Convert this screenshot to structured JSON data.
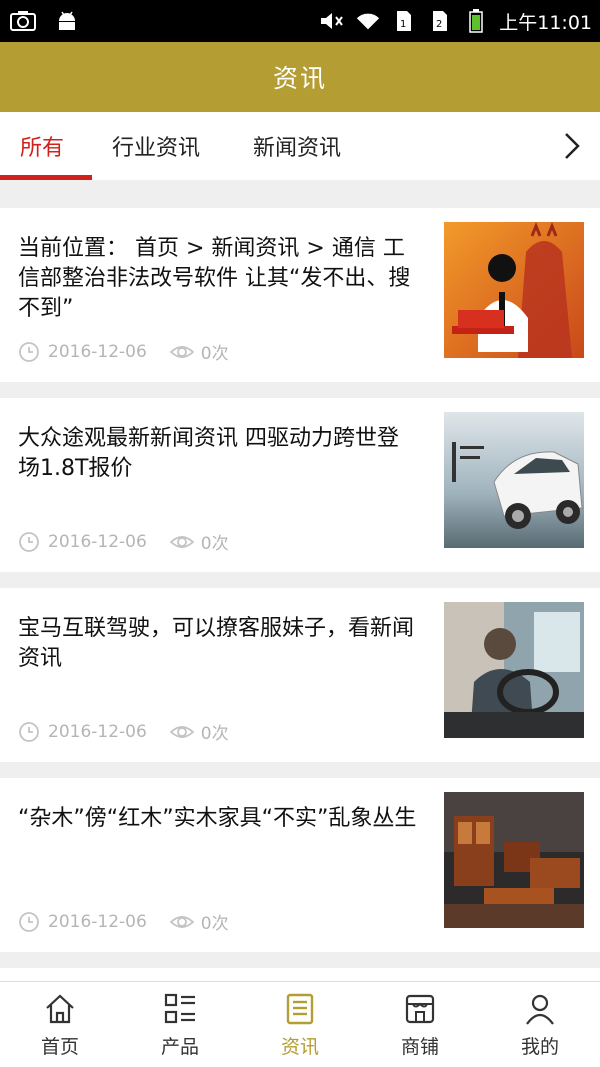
{
  "status_bar": {
    "time": "上午11:01",
    "icons_left": [
      "screenshot-icon",
      "android-icon"
    ],
    "icons_right": [
      "mute-icon",
      "wifi-icon",
      "sim1-icon",
      "sim2-icon",
      "battery-icon"
    ]
  },
  "header": {
    "title": "资讯"
  },
  "tabs": [
    {
      "label": "所有",
      "active": true
    },
    {
      "label": "行业资讯",
      "active": false
    },
    {
      "label": "新闻资讯",
      "active": false
    }
  ],
  "articles": [
    {
      "title": "当前位置： 首页 > 新闻资讯 > 通信 工信部整治非法改号软件 让其“发不出、搜不到”",
      "date": "2016-12-06",
      "views": "0次",
      "thumb": "devil-laptop"
    },
    {
      "title": "大众途观最新新闻资讯 四驱动力跨世登场1.8T报价",
      "date": "2016-12-06",
      "views": "0次",
      "thumb": "white-suv"
    },
    {
      "title": "宝马互联驾驶，可以撩客服妹子，看新闻资讯",
      "date": "2016-12-06",
      "views": "0次",
      "thumb": "driver-car"
    },
    {
      "title": "“杂木”傍“红木”实木家具“不实”乱象丛生",
      "date": "2016-12-06",
      "views": "0次",
      "thumb": "wood-furniture"
    }
  ],
  "bottom_nav": [
    {
      "label": "首页",
      "icon": "home-icon",
      "active": false
    },
    {
      "label": "产品",
      "icon": "grid-list-icon",
      "active": false
    },
    {
      "label": "资讯",
      "icon": "news-icon",
      "active": true
    },
    {
      "label": "商铺",
      "icon": "store-icon",
      "active": false
    },
    {
      "label": "我的",
      "icon": "user-icon",
      "active": false
    }
  ],
  "colors": {
    "brand": "#b49d32",
    "accent": "#d0211c",
    "meta": "#b5b5b5"
  }
}
